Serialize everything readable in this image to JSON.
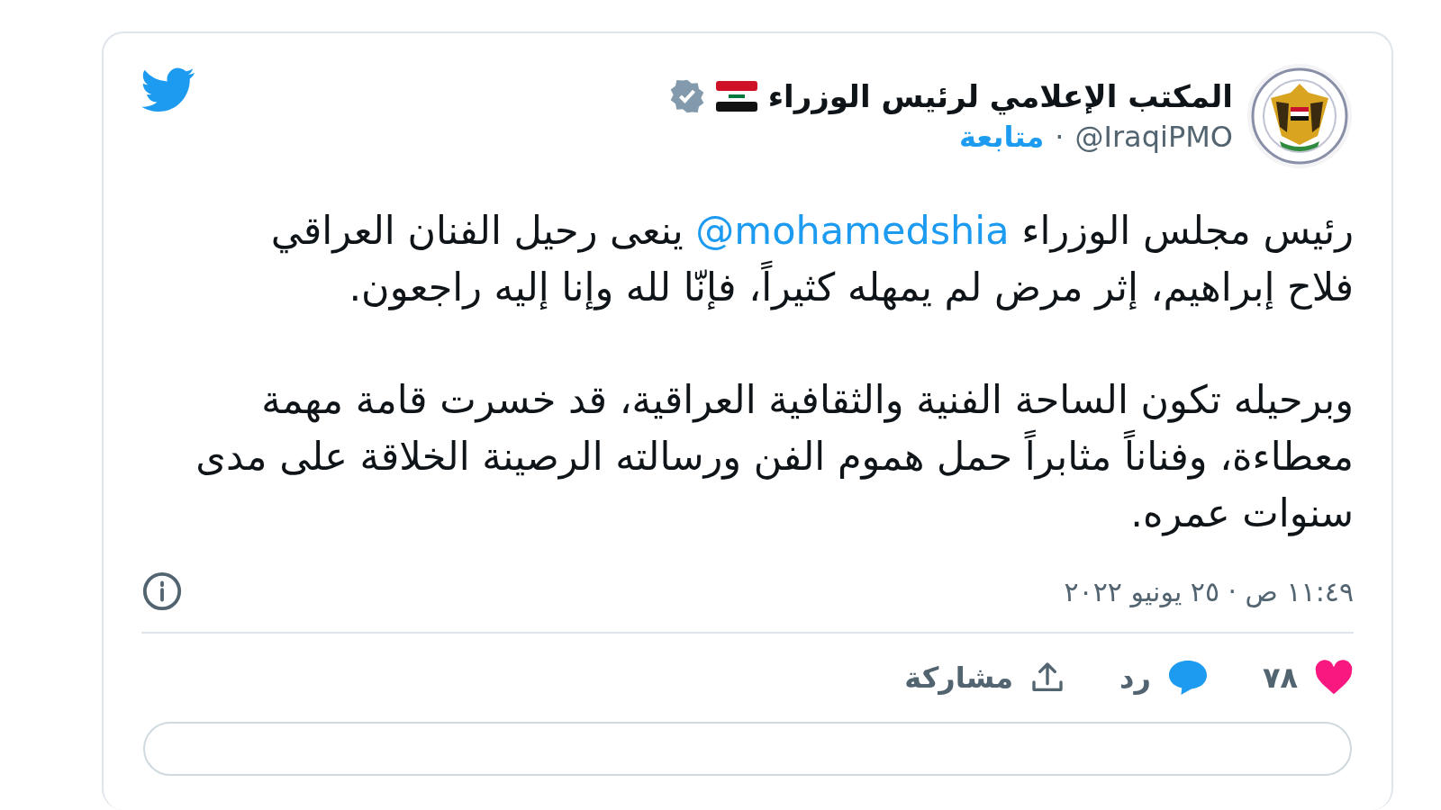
{
  "account": {
    "name": "المكتب الإعلامي لرئيس الوزراء",
    "verified": true,
    "handle": "@IraqiPMO",
    "separator": "·",
    "follow": "متابعة"
  },
  "tweet": {
    "paragraphs": [
      {
        "before": "رئيس مجلس الوزراء ",
        "mention": "@mohamedshia",
        "after": " ينعى رحيل الفنان العراقي فلاح إبراهيم، إثر مرض لم يمهله كثيراً، فإنّا لله وإنا إليه راجعون."
      },
      {
        "before": "وبرحيله تكون الساحة الفنية والثقافية العراقية، قد خسرت قامة مهمة معطاءة، وفناناً مثابراً حمل هموم الفن ورسالته الرصينة الخلاقة على مدى سنوات عمره."
      }
    ]
  },
  "timestamp": "١١:٤٩ ص · ٢٥ يونيو ٢٠٢٢",
  "actions": [
    {
      "kind": "like",
      "label": "٧٨"
    },
    {
      "kind": "reply",
      "label": "رد"
    },
    {
      "kind": "share",
      "label": "مشاركة"
    }
  ]
}
